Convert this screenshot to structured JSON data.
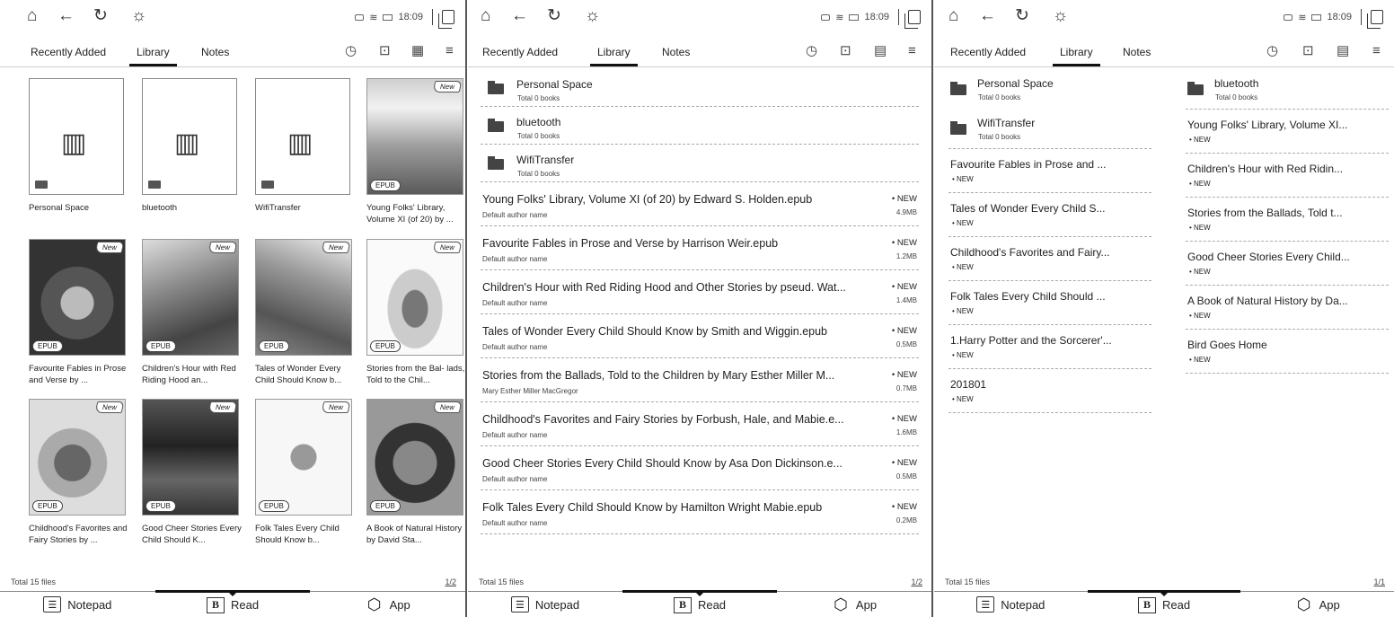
{
  "status": {
    "time": "18:09"
  },
  "tabs": {
    "recent": "Recently Added",
    "library": "Library",
    "notes": "Notes"
  },
  "bottom": {
    "notepad": "Notepad",
    "read": "Read",
    "app": "App"
  },
  "badges": {
    "new": "New",
    "epub": "EPUB",
    "new_list": "• NEW"
  },
  "folders": [
    {
      "name": "Personal Space",
      "count": "Total 0 books"
    },
    {
      "name": "bluetooth",
      "count": "Total 0 books"
    },
    {
      "name": "WifiTransfer",
      "count": "Total 0 books"
    }
  ],
  "panel1": {
    "total": "Total 15 files",
    "page": "1/2",
    "books": [
      {
        "title": "Young Folks' Library, Volume XI (of 20) by ..."
      },
      {
        "title": "Favourite Fables in Prose and Verse by ..."
      },
      {
        "title": "Children's Hour with Red Riding Hood an..."
      },
      {
        "title": "Tales of Wonder Every Child Should Know b..."
      },
      {
        "title": "Stories from the Bal- lads, Told to the Chil..."
      },
      {
        "title": "Childhood's Favorites and Fairy Stories by ..."
      },
      {
        "title": "Good Cheer Stories Every Child Should K..."
      },
      {
        "title": "Folk Tales Every Child Should Know b..."
      },
      {
        "title": "A Book of Natural History by David Sta..."
      }
    ]
  },
  "panel2": {
    "total": "Total 15 files",
    "page": "1/2",
    "books": [
      {
        "title": "Young Folks' Library, Volume XI (of 20) by Edward S. Holden.epub",
        "author": "Default author name",
        "size": "4.9MB"
      },
      {
        "title": "Favourite Fables in Prose and Verse by Harrison Weir.epub",
        "author": "Default author name",
        "size": "1.2MB"
      },
      {
        "title": "Children's Hour with Red Riding Hood and Other Stories by pseud. Wat...",
        "author": "Default author name",
        "size": "1.4MB"
      },
      {
        "title": "Tales of Wonder Every Child Should Know by Smith and Wiggin.epub",
        "author": "Default author name",
        "size": "0.5MB"
      },
      {
        "title": "Stories from the Ballads, Told to the Children by Mary Esther Miller M...",
        "author": "Mary Esther Miller MacGregor",
        "size": "0.7MB"
      },
      {
        "title": "Childhood's Favorites and Fairy Stories by Forbush, Hale, and Mabie.e...",
        "author": "Default author name",
        "size": "1.6MB"
      },
      {
        "title": "Good Cheer Stories Every Child Should Know by Asa Don Dickinson.e...",
        "author": "Default author name",
        "size": "0.5MB"
      },
      {
        "title": "Folk Tales Every Child Should Know by Hamilton Wright Mabie.epub",
        "author": "Default author name",
        "size": "0.2MB"
      }
    ]
  },
  "panel3": {
    "total": "Total 15 files",
    "page": "1/1",
    "left_books": [
      {
        "title": "Favourite Fables in Prose and ..."
      },
      {
        "title": "Tales of Wonder Every Child S..."
      },
      {
        "title": "Childhood's Favorites and Fairy..."
      },
      {
        "title": "Folk Tales Every Child Should ..."
      },
      {
        "title": "1.Harry Potter and the Sorcerer'..."
      },
      {
        "title": "201801"
      }
    ],
    "right_books": [
      {
        "title": "Young Folks' Library, Volume XI..."
      },
      {
        "title": "Children's Hour with Red Ridin..."
      },
      {
        "title": "Stories from the Ballads, Told t..."
      },
      {
        "title": "Good Cheer Stories Every Child..."
      },
      {
        "title": "A Book of Natural History by Da..."
      },
      {
        "title": "Bird Goes Home"
      }
    ]
  },
  "colors": {
    "ink": "#222222",
    "border": "#888888"
  },
  "icons": [
    "home-icon",
    "back-icon",
    "refresh-icon",
    "light-icon",
    "clock-icon",
    "import-icon",
    "grid-view-icon",
    "list-view-icon",
    "menu-icon",
    "folder-icon",
    "library-icon"
  ]
}
